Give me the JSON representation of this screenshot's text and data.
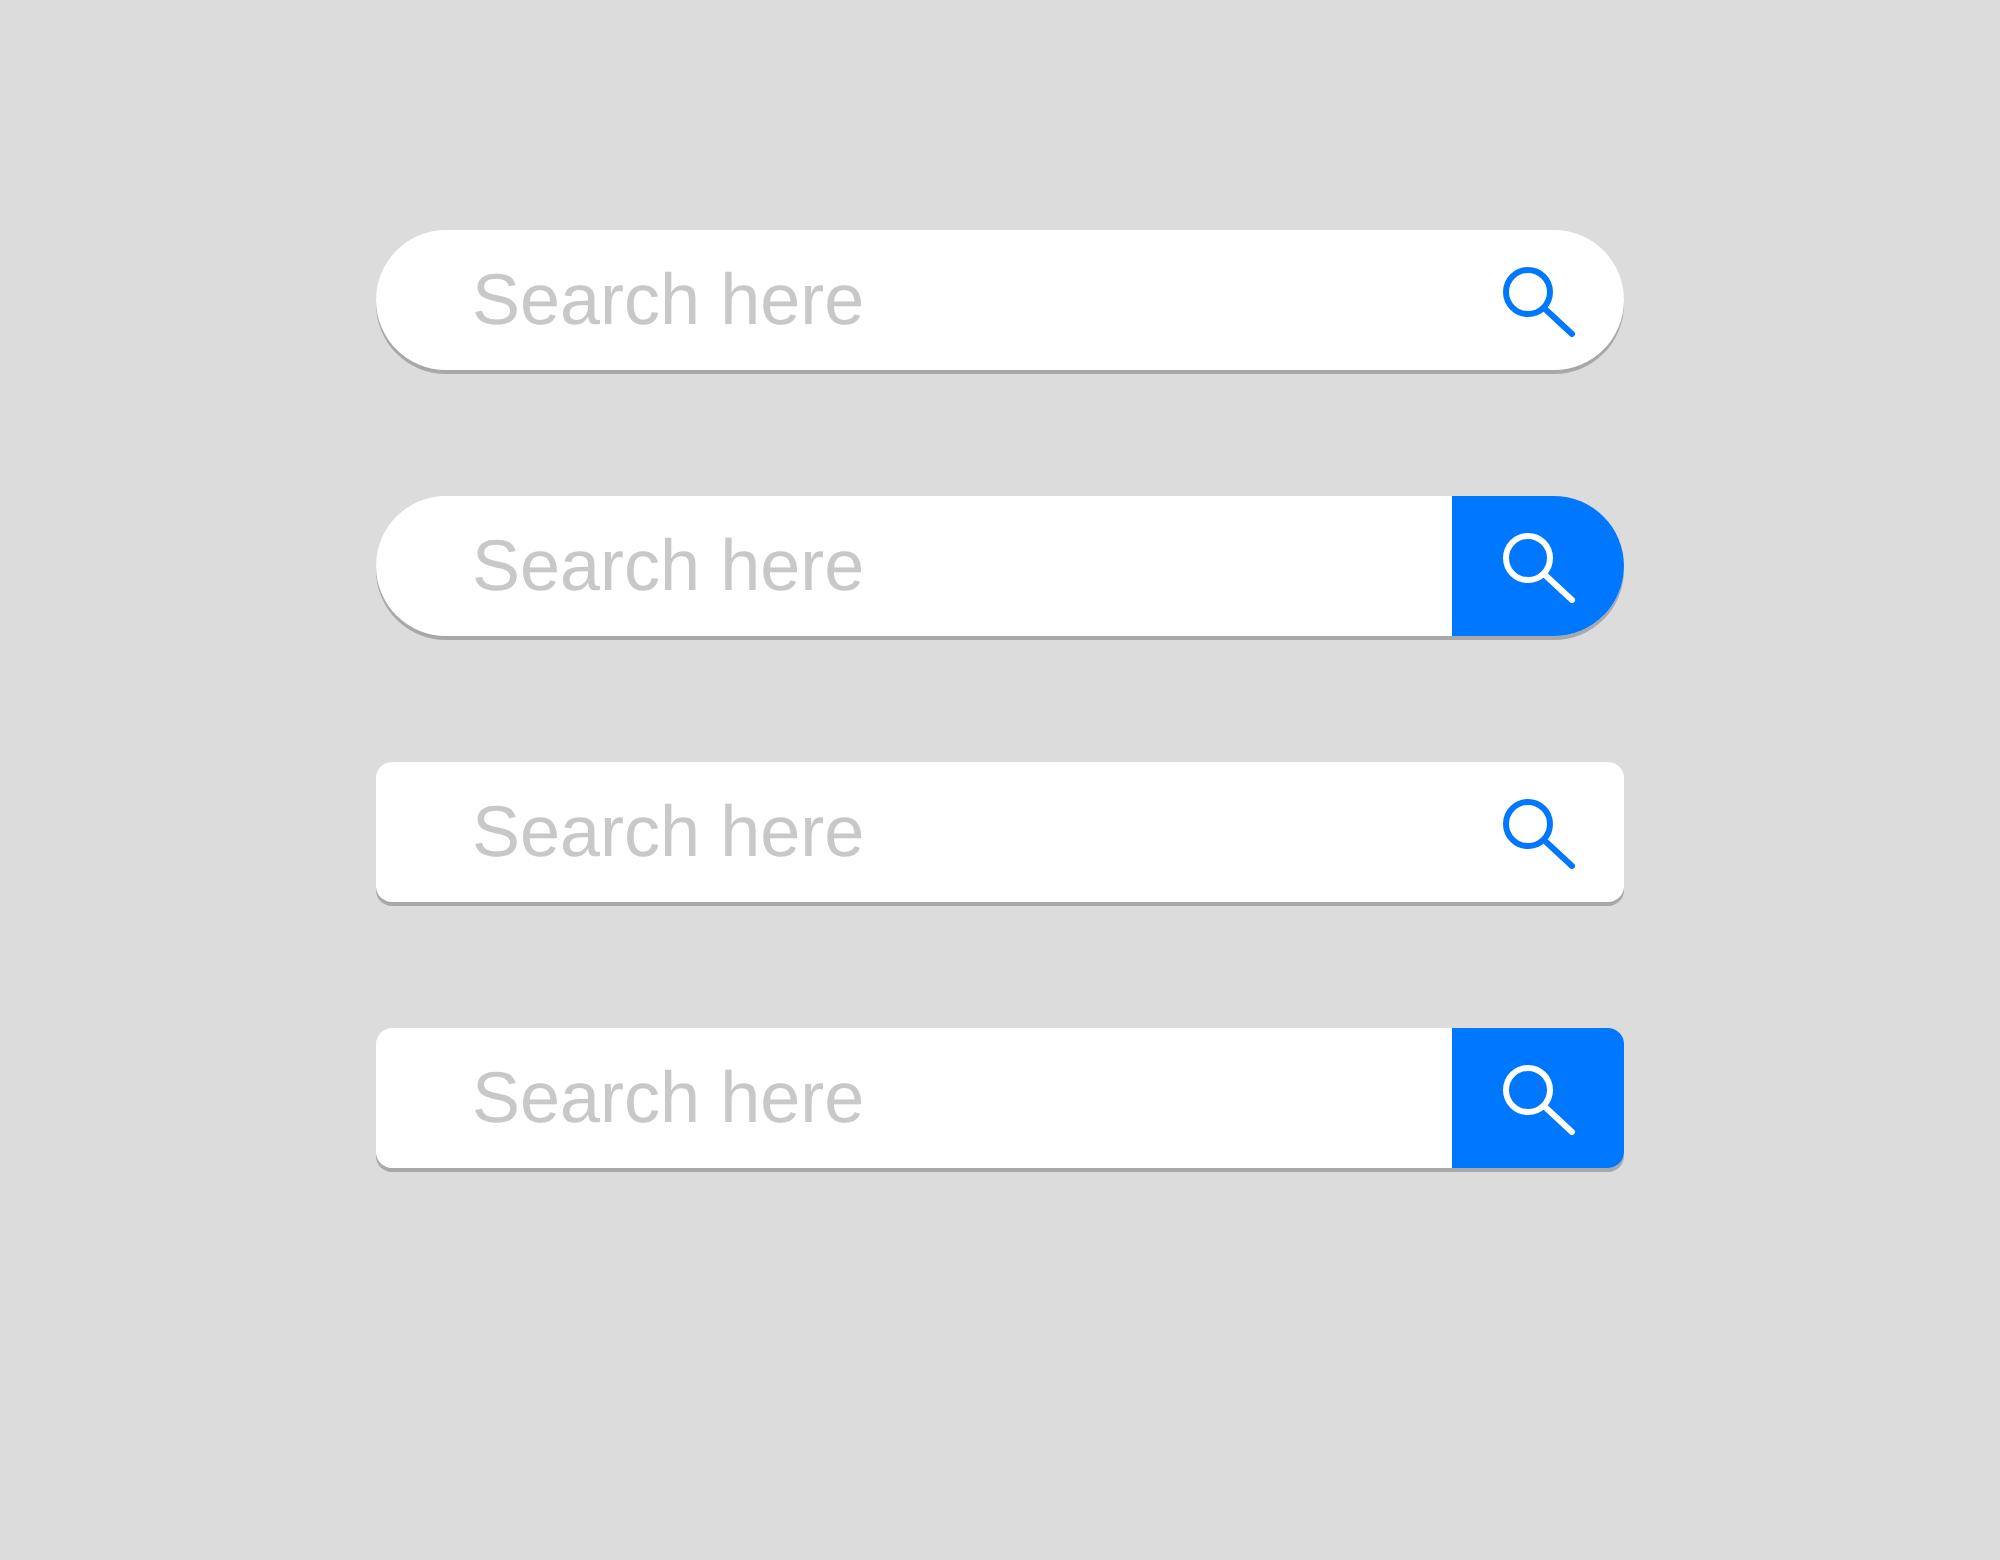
{
  "search_bars": [
    {
      "kind": "pill",
      "filled_button": false,
      "placeholder": "Search here"
    },
    {
      "kind": "pill",
      "filled_button": true,
      "placeholder": "Search here"
    },
    {
      "kind": "box",
      "filled_button": false,
      "placeholder": "Search here"
    },
    {
      "kind": "box",
      "filled_button": true,
      "placeholder": "Search here"
    }
  ]
}
